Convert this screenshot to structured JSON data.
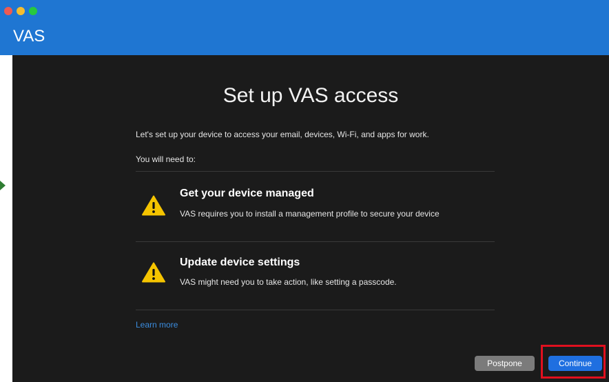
{
  "window": {
    "app_title": "VAS",
    "colors": {
      "titlebar": "#1f76d2",
      "background": "#1b1b1b",
      "accent": "#1f6fe0",
      "link": "#3b8de0",
      "warning": "#f5c400",
      "highlight_box": "#e0101f"
    },
    "traffic_lights": [
      "close-button",
      "minimize-button",
      "maximize-button"
    ]
  },
  "main": {
    "heading": "Set up VAS access",
    "intro": "Let's set up your device to access your email, devices, Wi-Fi, and apps for work.",
    "need_label": "You will need to:",
    "items": [
      {
        "icon": "warning-icon",
        "title": "Get your device managed",
        "description": "VAS requires you to install a management profile to secure your device"
      },
      {
        "icon": "warning-icon",
        "title": "Update device settings",
        "description": "VAS might need you to take action, like setting a passcode."
      }
    ],
    "learn_more": "Learn more"
  },
  "footer": {
    "postpone_label": "Postpone",
    "continue_label": "Continue"
  }
}
